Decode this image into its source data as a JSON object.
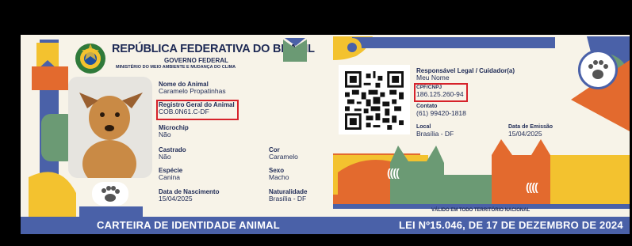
{
  "card": {
    "title": "REPÚBLICA FEDERATIVA DO BRASIL",
    "subtitle": "GOVERNO FEDERAL",
    "ministry": "MINISTÉRIO DO MEIO AMBIENTE E MUDANÇA DO CLIMA",
    "fields_left": [
      {
        "label": "Nome do Animal",
        "value": "Caramelo Propatinhas"
      },
      {
        "label": "Registro Geral do Animal",
        "value": "COB.0N61.C-DF"
      },
      {
        "label": "Microchip",
        "value": "Não"
      },
      {
        "label": "Castrado",
        "value": "Não"
      },
      {
        "label": "Espécie",
        "value": "Canina"
      },
      {
        "label": "Data de Nascimento",
        "value": "15/04/2025"
      }
    ],
    "fields_mid": [
      {
        "label": "Cor",
        "value": "Caramelo"
      },
      {
        "label": "Sexo",
        "value": "Macho"
      },
      {
        "label": "Naturalidade",
        "value": "Brasília - DF"
      }
    ],
    "fields_right": [
      {
        "label": "Responsável Legal / Cuidador(a)",
        "value": "Meu Nome"
      },
      {
        "label": "CPF/CNPJ",
        "value": "186.125.260-94"
      },
      {
        "label": "Contato",
        "value": "(61) 99420-1818"
      },
      {
        "label": "Local",
        "value": "Brasília - DF"
      },
      {
        "label": "Data de Emissão",
        "value": "15/04/2025"
      }
    ],
    "valid_text": "VÁLIDO EM TODO TERRITÓRIO NACIONAL",
    "banner_left": "CARTEIRA DE IDENTIDADE ANIMAL",
    "banner_right": "LEI Nº15.046, DE 17 DE DEZEMBRO DE 2024",
    "cat_stripes": "((((",
    "colors": {
      "navy": "#1e2a55",
      "blue": "#4a61a8",
      "yellow": "#f3c22f",
      "green": "#6b9a74",
      "orange": "#e36a2e",
      "red_box": "#d6222a",
      "cream": "#f7f3e8"
    }
  }
}
